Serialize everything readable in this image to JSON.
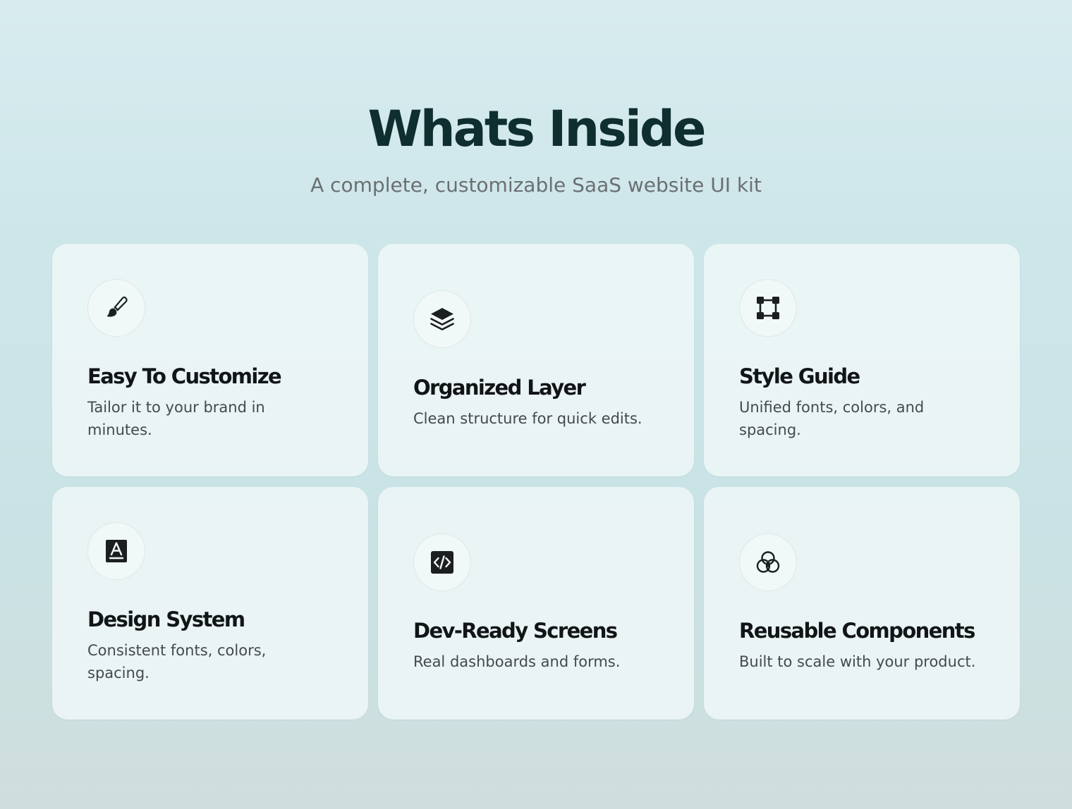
{
  "section": {
    "title": "Whats Inside",
    "subtitle": "A complete, customizable SaaS website UI kit"
  },
  "features": [
    {
      "icon": "paintbrush-icon",
      "title": "Easy To Customize",
      "description": "Tailor it to your brand in minutes."
    },
    {
      "icon": "layers-icon",
      "title": "Organized Layer",
      "description": "Clean structure for quick edits."
    },
    {
      "icon": "frame-nodes-icon",
      "title": "Style Guide",
      "description": "Unified fonts, colors, and spacing."
    },
    {
      "icon": "text-font-icon",
      "title": "Design System",
      "description": "Consistent fonts, colors, spacing."
    },
    {
      "icon": "code-icon",
      "title": "Dev-Ready Screens",
      "description": "Real dashboards and forms."
    },
    {
      "icon": "overlapping-circles-icon",
      "title": "Reusable Components",
      "description": "Built to scale with your product."
    }
  ],
  "colors": {
    "title": "#0f2e30",
    "subtitle": "#6b6f72",
    "card_title": "#121517",
    "card_text": "#45494c",
    "icon": "#1c1f21"
  }
}
